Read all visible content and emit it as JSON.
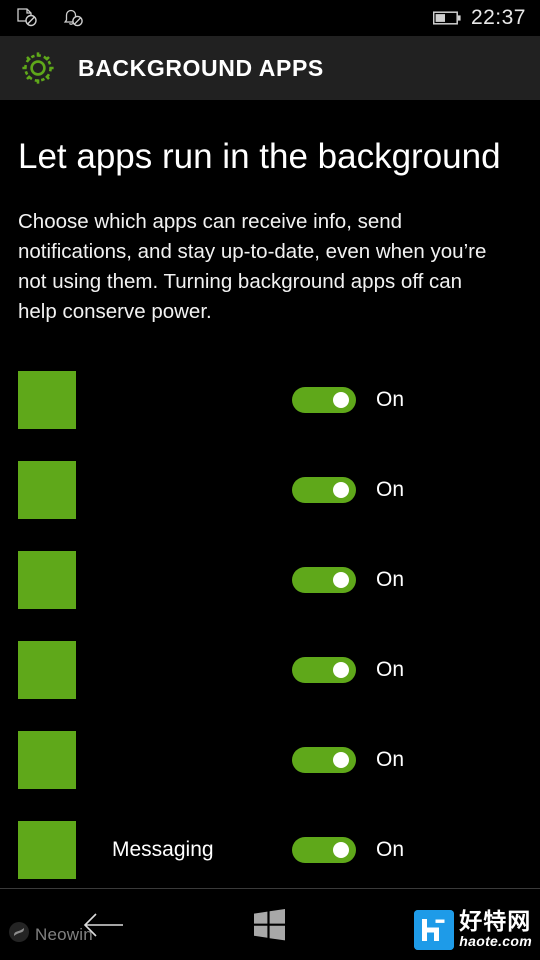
{
  "statusbar": {
    "icons": [
      {
        "name": "driving-mode-off-icon",
        "label": "driving-mode-off"
      },
      {
        "name": "quiet-hours-icon",
        "label": "notifications-off"
      }
    ],
    "battery": {
      "name": "battery-icon",
      "level_percent": 45
    },
    "clock": "22:37"
  },
  "header": {
    "icon": "settings-gear-icon",
    "title": "BACKGROUND APPS",
    "accent_color": "#5FA81A",
    "background_color": "#212121"
  },
  "page": {
    "heading": "Let apps run in the background",
    "description": "Choose which apps can receive info, send notifications, and stay up-to-date, even when you’re not using them. Turning background apps off can help conserve power."
  },
  "app_list": {
    "tile_color": "#5FA81A",
    "toggle_on_color": "#5FA81A",
    "items": [
      {
        "name": "",
        "toggle_state": "On",
        "toggle_on": true,
        "tile": "app-tile-placeholder"
      },
      {
        "name": "",
        "toggle_state": "On",
        "toggle_on": true,
        "tile": "app-tile-placeholder"
      },
      {
        "name": "",
        "toggle_state": "On",
        "toggle_on": true,
        "tile": "app-tile-placeholder"
      },
      {
        "name": "",
        "toggle_state": "On",
        "toggle_on": true,
        "tile": "app-tile-placeholder"
      },
      {
        "name": "",
        "toggle_state": "On",
        "toggle_on": true,
        "tile": "app-tile-placeholder"
      },
      {
        "name": "Messaging",
        "toggle_state": "On",
        "toggle_on": true,
        "tile": "app-tile-placeholder"
      }
    ]
  },
  "navbar": {
    "back_icon": "back-arrow-icon",
    "start_icon": "windows-start-icon"
  },
  "watermarks": {
    "neowin": {
      "icon": "neowin-logo-icon",
      "text": "Neowin"
    },
    "haote": {
      "badge_letter": "H",
      "cn_text": "好特网",
      "url": "haote.com",
      "badge_color": "#1E9BE8"
    }
  }
}
